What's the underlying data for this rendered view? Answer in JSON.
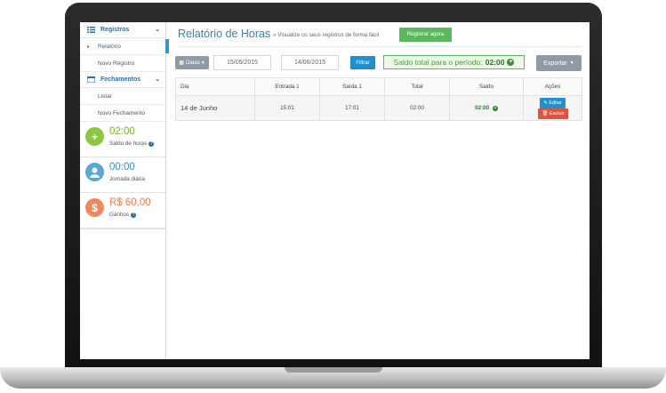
{
  "sidebar": {
    "registros_label": "Registros",
    "registros_items": [
      "Relatório",
      "Novo Registro"
    ],
    "fechamentos_label": "Fechamentos",
    "fechamentos_items": [
      "Listar",
      "Novo Fechamento"
    ],
    "stats": [
      {
        "value": "02:00",
        "label": "Saldo de horas",
        "icon": "plus-icon",
        "color": "#8dc63f"
      },
      {
        "value": "00:00",
        "label": "Jornada diária",
        "icon": "user-icon",
        "color": "#5aa6d6"
      },
      {
        "value": "R$ 60,00",
        "label": "Ganhos",
        "icon": "dollar-icon",
        "color": "#f0885a"
      }
    ]
  },
  "header": {
    "title": "Relatório de Horas",
    "subtitle": "» Visualize os seus registros de forma fácil",
    "register_button": "Registrar agora"
  },
  "filters": {
    "datas_label": "Datas",
    "start_date": "15/05/2015",
    "end_date": "14/06/2015",
    "filter_button": "Filtrar",
    "saldo_label": "Saldo total para o período:",
    "saldo_value": "02:00",
    "export_button": "Exportar"
  },
  "table": {
    "headers": [
      "Dia",
      "Entrada 1",
      "Saída 1",
      "Total",
      "Saldo",
      "Ações"
    ],
    "rows": [
      {
        "dia": "14 de Junho",
        "entrada": "15:01",
        "saida": "17:01",
        "total": "02:00",
        "saldo": "02:00",
        "edit": "Editar",
        "delete": "Excluir"
      }
    ]
  },
  "colors": {
    "accent": "#2a6ea6",
    "success": "#5cb85c",
    "danger": "#e2533f",
    "primary": "#1f8fcf"
  }
}
